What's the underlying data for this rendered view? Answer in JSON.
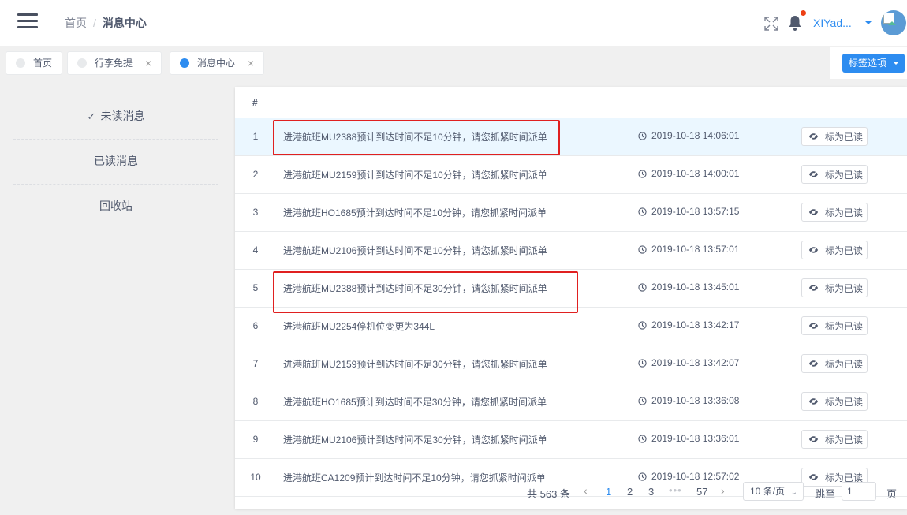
{
  "header": {
    "breadcrumb": {
      "home": "首页",
      "separator": "/",
      "current": "消息中心"
    },
    "username": "XIYad...",
    "icons": {
      "menu": "hamburger-icon",
      "fullscreen": "fullscreen-icon",
      "notification": "bell-icon",
      "avatar": "broken-image-icon"
    }
  },
  "tags": {
    "items": [
      {
        "label": "首页",
        "active": false,
        "closable": false
      },
      {
        "label": "行李免提",
        "active": false,
        "closable": true
      },
      {
        "label": "消息中心",
        "active": true,
        "closable": true
      }
    ],
    "close_symbol": "×",
    "options_label": "标签选项"
  },
  "sidebar": {
    "items": [
      {
        "label": "未读消息",
        "selected": true
      },
      {
        "label": "已读消息",
        "selected": false
      },
      {
        "label": "回收站",
        "selected": false
      }
    ],
    "check_symbol": "✓"
  },
  "table": {
    "header": {
      "index": "#"
    },
    "mark_label": "标为已读",
    "rows": [
      {
        "index": "1",
        "message": "进港航班MU2388预计到达时间不足10分钟，请您抓紧时间派单",
        "time": "2019-10-18 14:06:01"
      },
      {
        "index": "2",
        "message": "进港航班MU2159预计到达时间不足10分钟，请您抓紧时间派单",
        "time": "2019-10-18 14:00:01"
      },
      {
        "index": "3",
        "message": "进港航班HO1685预计到达时间不足10分钟，请您抓紧时间派单",
        "time": "2019-10-18 13:57:15"
      },
      {
        "index": "4",
        "message": "进港航班MU2106预计到达时间不足10分钟，请您抓紧时间派单",
        "time": "2019-10-18 13:57:01"
      },
      {
        "index": "5",
        "message": "进港航班MU2388预计到达时间不足30分钟，请您抓紧时间派单",
        "time": "2019-10-18 13:45:01"
      },
      {
        "index": "6",
        "message": "进港航班MU2254停机位变更为344L",
        "time": "2019-10-18 13:42:17"
      },
      {
        "index": "7",
        "message": "进港航班MU2159预计到达时间不足30分钟，请您抓紧时间派单",
        "time": "2019-10-18 13:42:07"
      },
      {
        "index": "8",
        "message": "进港航班HO1685预计到达时间不足30分钟，请您抓紧时间派单",
        "time": "2019-10-18 13:36:08"
      },
      {
        "index": "9",
        "message": "进港航班MU2106预计到达时间不足30分钟，请您抓紧时间派单",
        "time": "2019-10-18 13:36:01"
      },
      {
        "index": "10",
        "message": "进港航班CA1209预计到达时间不足10分钟，请您抓紧时间派单",
        "time": "2019-10-18 12:57:02"
      }
    ]
  },
  "pagination": {
    "total": "共 563 条",
    "prev": "‹",
    "next": "›",
    "pages": [
      "1",
      "2",
      "3"
    ],
    "ellipsis": "•••",
    "last_page": "57",
    "current_page": "1",
    "page_size": "10 条/页",
    "jump_label": "跳至",
    "jump_value": "1",
    "page_unit": "页"
  },
  "colors": {
    "primary": "#2d8cf0",
    "highlight_row": "#ebf7ff",
    "annotation": "#e02020",
    "badge": "#ed4014"
  }
}
